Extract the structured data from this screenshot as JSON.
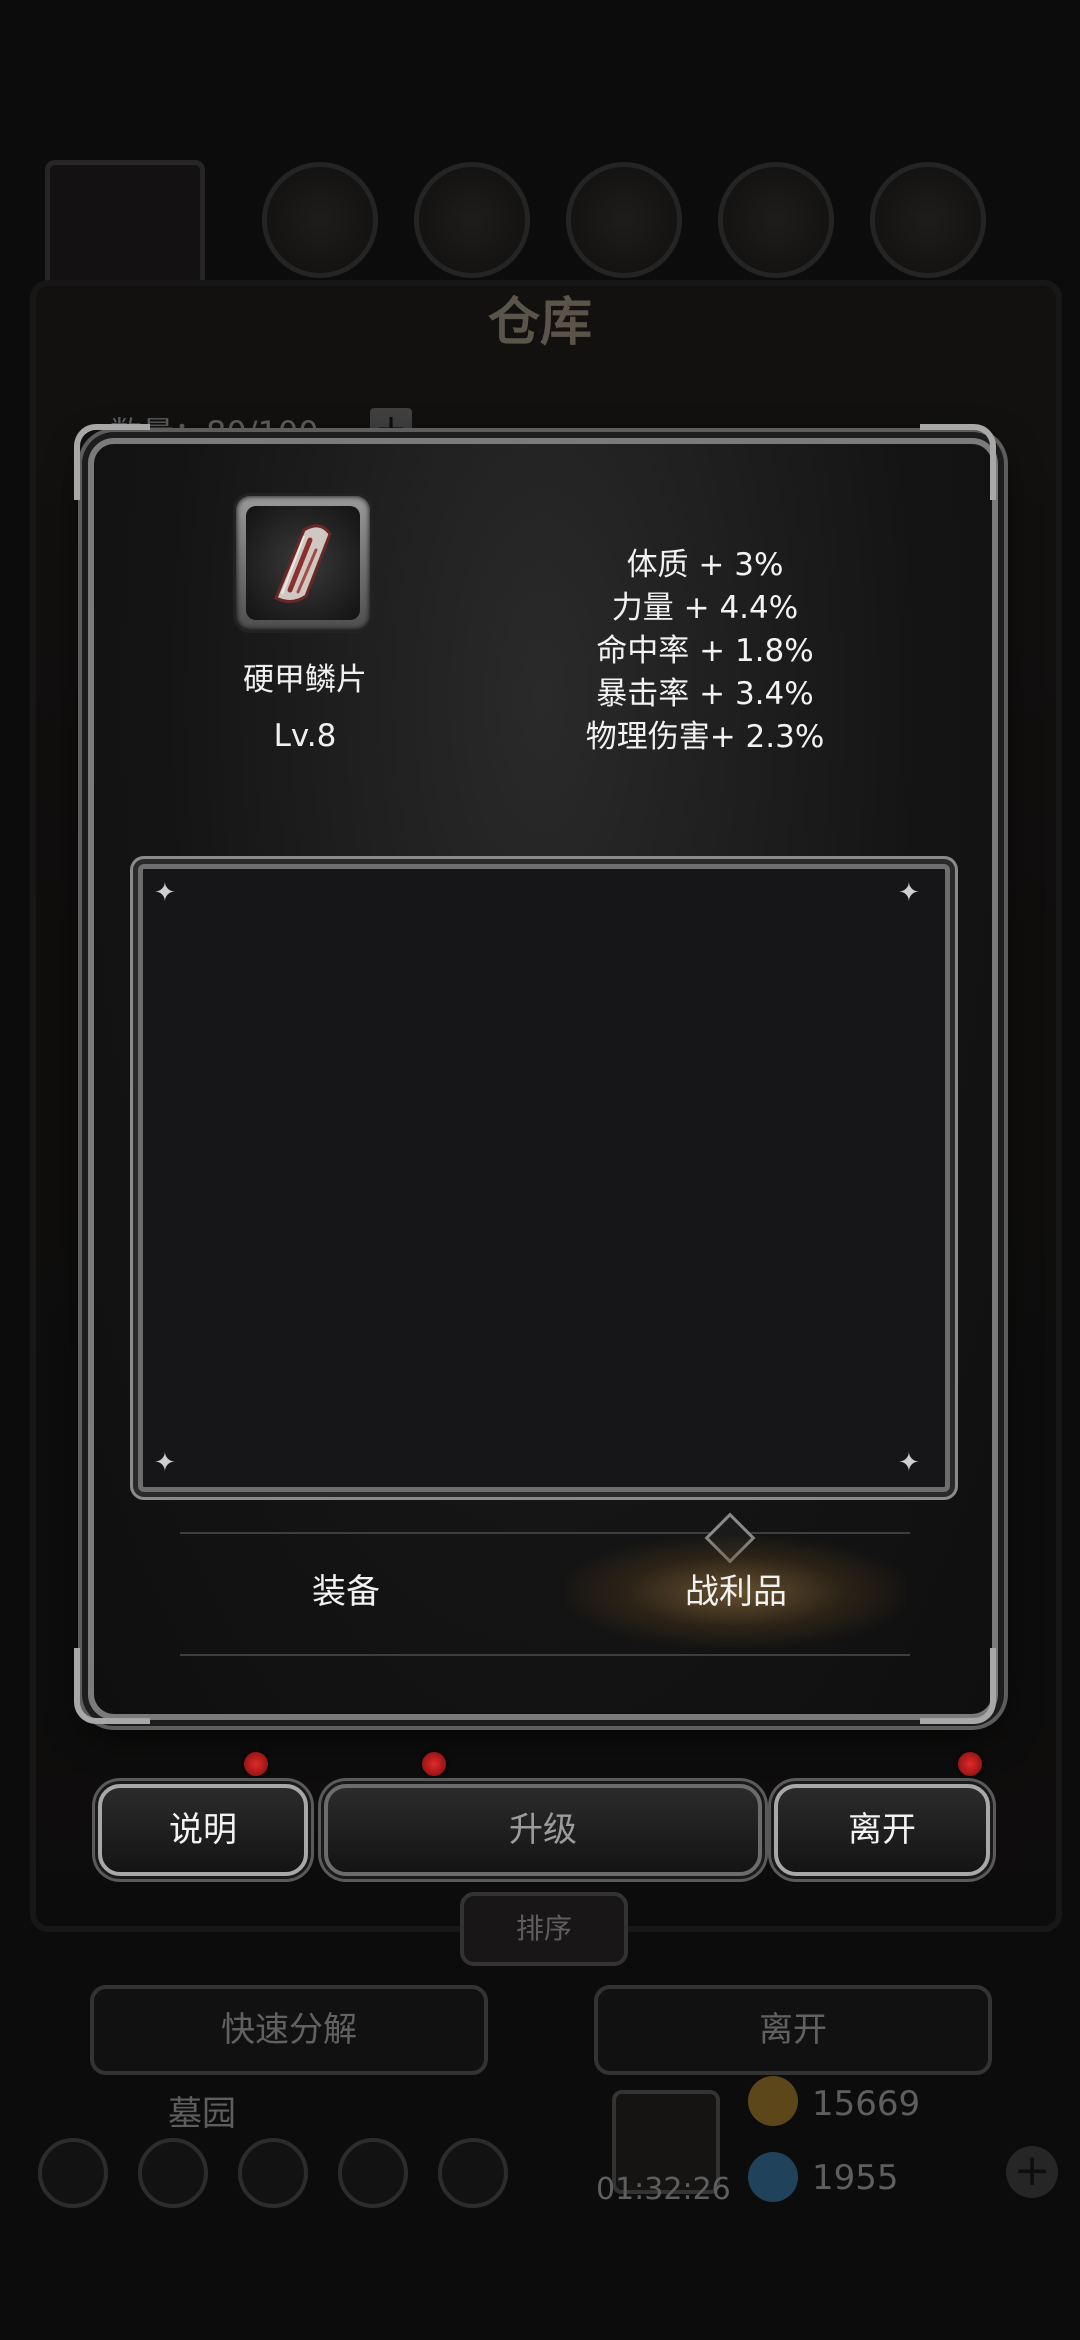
{
  "background": {
    "title": "仓库",
    "capacity": "数量：80/100",
    "capacity_plus": "+",
    "sort_button": "排序",
    "quick_decompose_button": "快速分解",
    "leave_button": "离开",
    "location": "墓园",
    "gold": "15669",
    "gems": "1955",
    "timer": "01:32:26"
  },
  "item": {
    "name": "硬甲鳞片",
    "level": "Lv.8",
    "icon": "scale-icon",
    "stats": [
      "体质 + 3%",
      "力量 + 4.4%",
      "命中率 + 1.8%",
      "暴击率 + 3.4%",
      "物理伤害+ 2.3%"
    ]
  },
  "tabs": [
    {
      "label": "装备",
      "active": false
    },
    {
      "label": "战利品",
      "active": true
    }
  ],
  "actions": {
    "explain": "说明",
    "upgrade": "升级",
    "leave": "离开"
  },
  "colors": {
    "accent_gold": "#a8823f",
    "notification_red": "#d42222"
  }
}
